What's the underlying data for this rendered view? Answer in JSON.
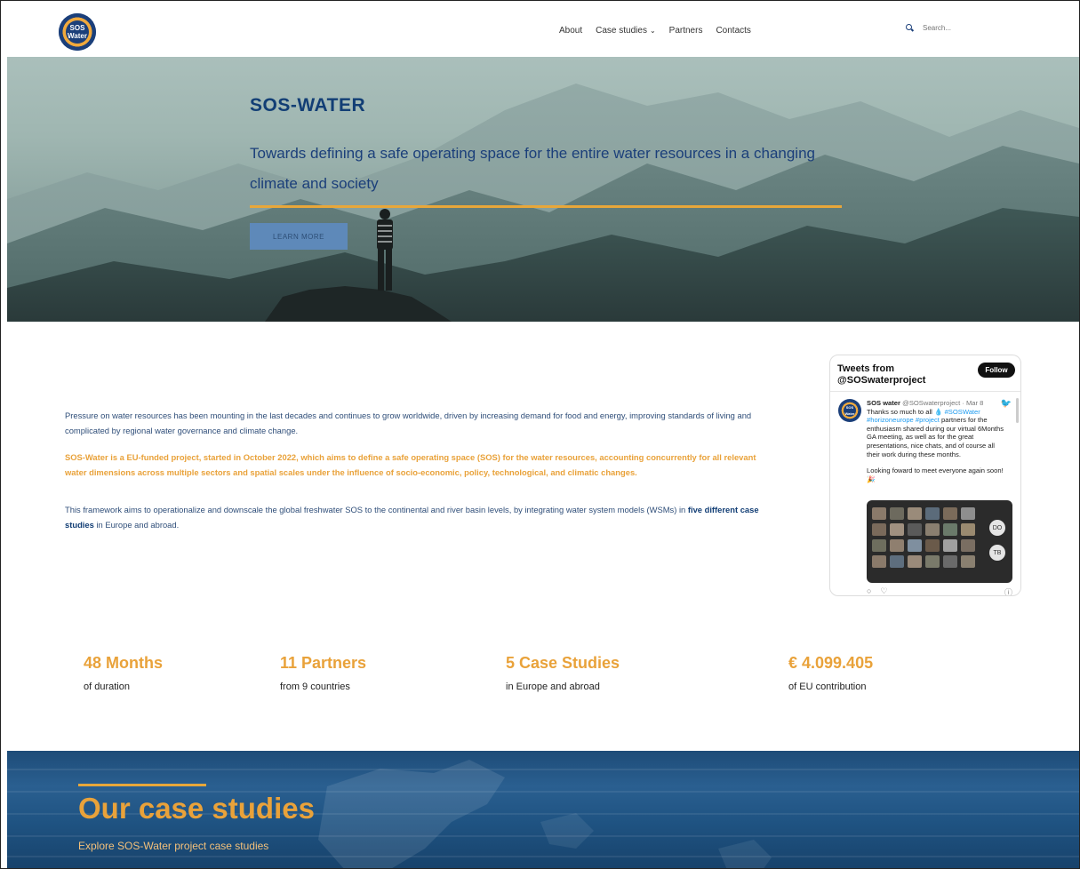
{
  "nav": {
    "logo_text_1": "SOS",
    "logo_text_2": "Water",
    "menu": [
      "About",
      "Case studies",
      "Partners",
      "Contacts"
    ],
    "search_placeholder": "Search..."
  },
  "hero": {
    "title": "SOS-WATER",
    "subtitle": "Towards defining a safe operating space for the entire water resources in a changing climate and society",
    "button": "LEARN MORE"
  },
  "intro": {
    "p1": "Pressure on water resources has been mounting in the last decades and continues to grow worldwide, driven by increasing demand for food and energy, improving standards of living and complicated by regional water governance and climate change.",
    "p2": "SOS-Water is a EU-funded project, started in October 2022, which aims to define a safe operating space (SOS) for the water resources, accounting concurrently for all relevant water dimensions across multiple sectors and spatial scales under the influence of socio-economic, policy, technological, and climatic changes.",
    "p3_a": "This framework aims to operationalize and downscale the global freshwater SOS to the continental and river basin levels, by integrating water system models (WSMs) in ",
    "p3_b": "five different case studies",
    "p3_c": " in Europe and abroad."
  },
  "twitter": {
    "header": "Tweets from @SOSwaterproject",
    "follow": "Follow",
    "name": "SOS water",
    "handle": "@SOSwaterproject · Mar 8",
    "text_a": "Thanks so much to all 💧",
    "tag1": "#SOSWater",
    "tag2": "#horizoneurope",
    "tag3": "#project",
    "text_b": " partners for the enthusiasm shared during our virtual 6Months GA meeting, as well as for the great presentations, nice chats, and of course all their work during these months.",
    "text_c": "Looking foward to meet everyone again soon! 🎉",
    "badge1": "DO",
    "badge2": "TB"
  },
  "stats": [
    {
      "value": "48 Months",
      "label": "of duration"
    },
    {
      "value": "11 Partners",
      "label": "from 9 countries"
    },
    {
      "value": "5 Case Studies",
      "label": "in Europe and abroad"
    },
    {
      "value": "€ 4.099.405",
      "label": "of EU contribution"
    }
  ],
  "case_studies": {
    "title": "Our case studies",
    "subtitle": "Explore SOS-Water project case studies"
  },
  "colors": {
    "accent": "#e9a23a",
    "brand": "#123e75",
    "twitter": "#1d9bf0"
  }
}
